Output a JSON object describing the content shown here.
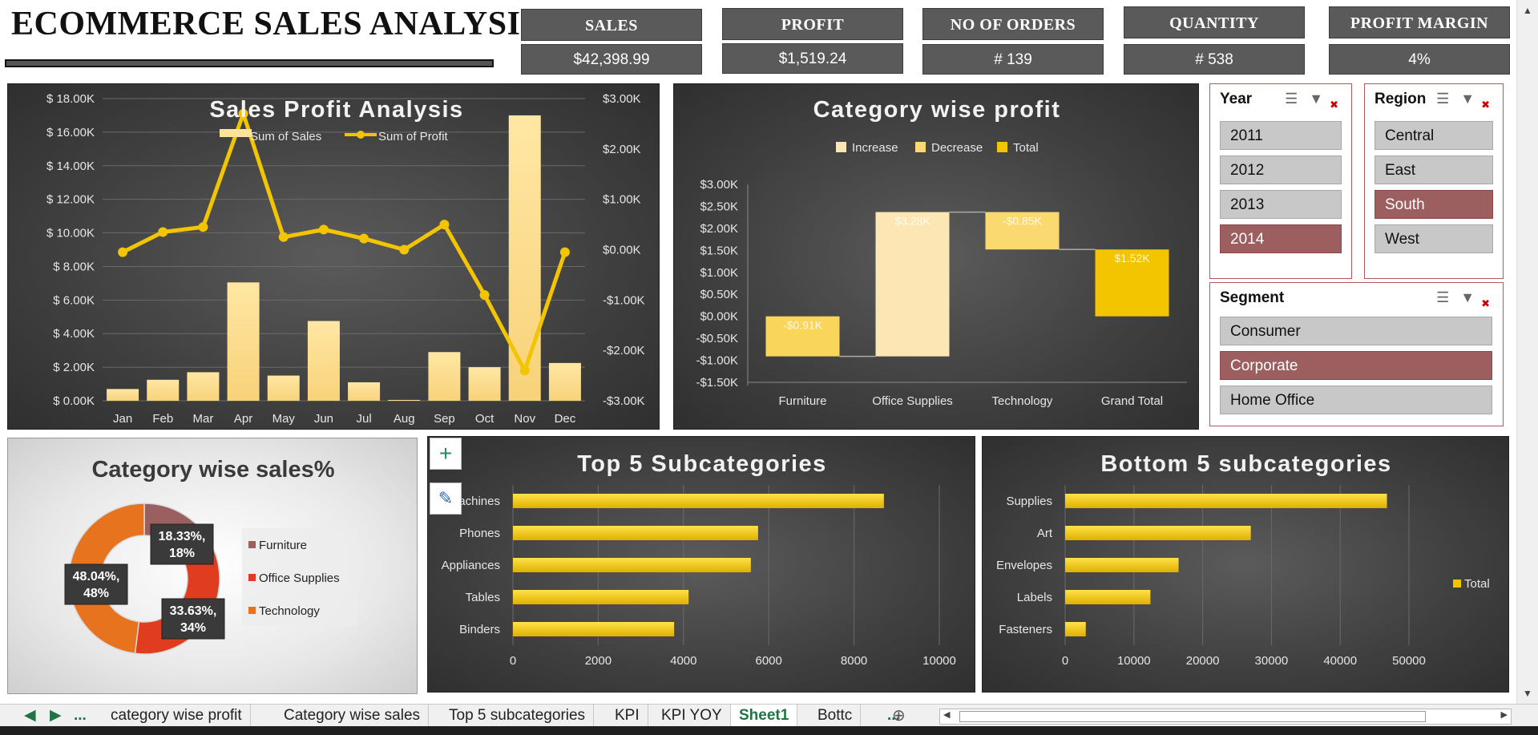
{
  "title": "ECOMMERCE SALES ANALYSIS",
  "kpis": [
    {
      "label": "SALES",
      "value": "$42,398.99"
    },
    {
      "label": "PROFIT",
      "value": "$1,519.24"
    },
    {
      "label": "NO OF ORDERS",
      "value": "# 139"
    },
    {
      "label": "QUANTITY",
      "value": "# 538"
    },
    {
      "label": "PROFIT MARGIN",
      "value": "4%"
    }
  ],
  "colors": {
    "gold": "#f2c500",
    "gold_light": "#fde39a",
    "slicer_selected": "#9c5e5e",
    "furniture": "#9a6060",
    "office_supplies": "#e03c20",
    "technology": "#e8731e",
    "excel_green": "#217346"
  },
  "slicers": {
    "year": {
      "title": "Year",
      "items": [
        "2011",
        "2012",
        "2013",
        "2014"
      ],
      "selected": "2014"
    },
    "region": {
      "title": "Region",
      "items": [
        "Central",
        "East",
        "South",
        "West"
      ],
      "selected": "South"
    },
    "segment": {
      "title": "Segment",
      "items": [
        "Consumer",
        "Corporate",
        "Home Office"
      ],
      "selected": "Corporate"
    }
  },
  "chart_data": [
    {
      "type": "bar",
      "title": "Sales  Profit Analysis",
      "categories": [
        "Jan",
        "Feb",
        "Mar",
        "Apr",
        "May",
        "Jun",
        "Jul",
        "Aug",
        "Sep",
        "Oct",
        "Nov",
        "Dec"
      ],
      "series": [
        {
          "name": "Sum of Sales",
          "type": "bar",
          "axis": "left",
          "values": [
            700,
            1250,
            1700,
            7050,
            1500,
            4750,
            1100,
            50,
            2900,
            2000,
            17000,
            2250
          ]
        },
        {
          "name": "Sum of Profit",
          "type": "line",
          "axis": "right",
          "values": [
            -50,
            350,
            450,
            2700,
            250,
            400,
            220,
            0,
            500,
            -900,
            -2400,
            -50
          ]
        }
      ],
      "ylim_left": [
        0,
        18000
      ],
      "ylim_right": [
        -3000,
        3000
      ],
      "yticks_left": [
        "$ 0.00K",
        "$ 2.00K",
        "$ 4.00K",
        "$ 6.00K",
        "$ 8.00K",
        "$ 10.00K",
        "$ 12.00K",
        "$ 14.00K",
        "$ 16.00K",
        "$ 18.00K"
      ],
      "yticks_right": [
        "-$3.00K",
        "-$2.00K",
        "-$1.00K",
        "$0.00K",
        "$1.00K",
        "$2.00K",
        "$3.00K"
      ],
      "legend": "top-center"
    },
    {
      "type": "waterfall",
      "title": "Category wise profit",
      "categories": [
        "Furniture",
        "Office Supplies",
        "Technology",
        "Grand Total"
      ],
      "values": [
        -910,
        3280,
        -850,
        1520
      ],
      "data_labels": [
        "-$0.91K",
        "$3.28K",
        "-$0.85K",
        "$1.52K"
      ],
      "legend_entries": [
        "Increase",
        "Decrease",
        "Total"
      ],
      "ylim": [
        -1500,
        3000
      ],
      "yticks": [
        "-$1.50K",
        "-$1.00K",
        "-$0.50K",
        "$0.00K",
        "$0.50K",
        "$1.00K",
        "$1.50K",
        "$2.00K",
        "$2.50K",
        "$3.00K"
      ],
      "legend": "top-center"
    },
    {
      "type": "pie",
      "title": "Category wise sales%",
      "categories": [
        "Furniture",
        "Office Supplies",
        "Technology"
      ],
      "values": [
        18.33,
        33.63,
        48.04
      ],
      "data_labels": [
        "18.33%, 18%",
        "33.63%, 34%",
        "48.04%, 48%"
      ],
      "legend": "right"
    },
    {
      "type": "bar",
      "orientation": "horizontal",
      "title": "Top 5 Subcategories",
      "categories": [
        "Machines",
        "Phones",
        "Appliances",
        "Tables",
        "Binders"
      ],
      "values": [
        8700,
        5750,
        5580,
        4120,
        3780
      ],
      "xlim": [
        0,
        10000
      ],
      "xticks": [
        "0",
        "2000",
        "4000",
        "6000",
        "8000",
        "10000"
      ]
    },
    {
      "type": "bar",
      "orientation": "horizontal",
      "title": "Bottom 5 subcategories",
      "categories": [
        "Supplies",
        "Art",
        "Envelopes",
        "Labels",
        "Fasteners"
      ],
      "series": [
        {
          "name": "Total",
          "values": [
            46800,
            27000,
            16500,
            12400,
            3000
          ]
        }
      ],
      "xlim": [
        0,
        50000
      ],
      "xticks": [
        "0",
        "10000",
        "20000",
        "30000",
        "40000",
        "50000"
      ],
      "legend": "right"
    }
  ],
  "sheet_tabs": {
    "items": [
      "category wise profit",
      "Category wise sales",
      "Top 5 subcategories",
      "KPI",
      "KPI YOY",
      "Sheet1",
      "Bottc"
    ],
    "active": "Sheet1",
    "ellipsis": "...",
    "ellipsis_right": "..."
  }
}
